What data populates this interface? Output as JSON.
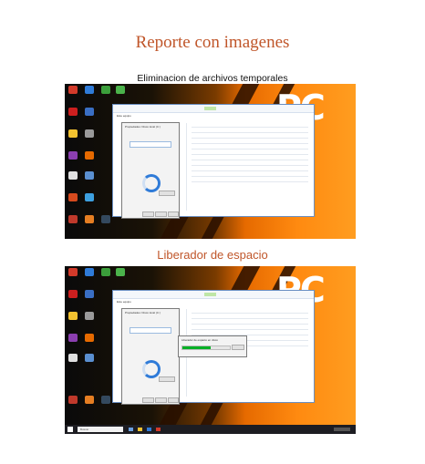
{
  "document": {
    "title": "Reporte con imagenes",
    "sections": [
      {
        "caption": "Eliminacion de archivos temporales"
      },
      {
        "caption": "Liberador de espacio"
      }
    ]
  },
  "colors": {
    "heading": "#c0562a",
    "desktop_orange": "#ff8a10",
    "window_border": "#6a8fc2"
  },
  "screenshots": {
    "brand_mark": "PC",
    "dialog_title": "Propiedades: Disco local (C:)",
    "explorer_title": "Este equipo",
    "cleanup_title": "Liberador de espacio en disco",
    "taskbar_search": "Buscar"
  }
}
